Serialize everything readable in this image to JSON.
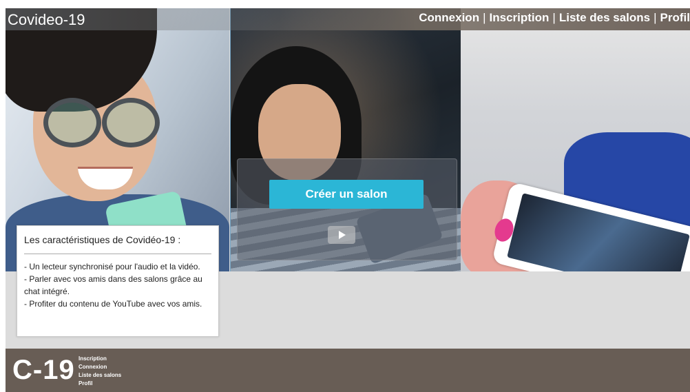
{
  "header": {
    "site_title": "Covideo-19",
    "nav": [
      "Connexion",
      "Inscription",
      "Liste des salons",
      "Profil"
    ],
    "separator": "|"
  },
  "hero": {
    "create_room_label": "Créer un salon"
  },
  "features": {
    "title": "Les caractéristiques de Covidéo-19 :",
    "items": [
      "- Un lecteur synchronisé pour l'audio et la vidéo.",
      "- Parler avec vos amis dans des salons grâce au chat intégré.",
      "- Profiter du contenu de YouTube avec vos amis."
    ]
  },
  "footer": {
    "logo": "C-19",
    "links": [
      "Inscription",
      "Connexion",
      "Liste des salons",
      "Profil"
    ]
  },
  "colors": {
    "accent": "#2bb6d6",
    "footer_bg": "#685d55",
    "page_bg": "#dcdcdc"
  },
  "icons": {
    "play": "play-icon"
  }
}
